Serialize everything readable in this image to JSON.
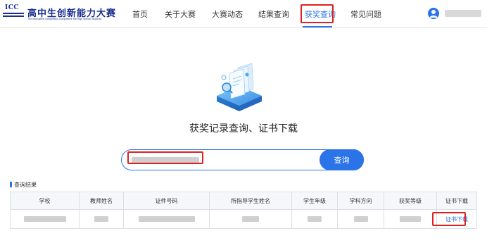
{
  "logo": {
    "abbr": "ICC",
    "name": "高中生创新能力大赛",
    "subtitle": "The Innovative Competition Competitive the High School Students",
    "brand_color": "#1b2f8f"
  },
  "nav": {
    "items": [
      {
        "label": "首页",
        "active": false
      },
      {
        "label": "关于大赛",
        "active": false
      },
      {
        "label": "大赛动态",
        "active": false
      },
      {
        "label": "结果查询",
        "active": false
      },
      {
        "label": "获奖查询",
        "active": true
      },
      {
        "label": "常见问题",
        "active": false
      }
    ],
    "accent_color": "#2a73e8",
    "highlight_color": "#e02020"
  },
  "user": {
    "avatar_icon": "user-avatar-icon"
  },
  "hero": {
    "illustration_icon": "certificate-stack-icon",
    "title": "获奖记录查询、证书下载"
  },
  "search": {
    "placeholder": "",
    "value": "",
    "button_label": "查询"
  },
  "results": {
    "section_label": "查询结果",
    "columns": [
      "学校",
      "教师姓名",
      "证件号码",
      "所指导学生姓名",
      "学生年级",
      "学科方向",
      "获奖等级",
      "证书下载"
    ],
    "rows": [
      {
        "download_label": "证书下载"
      }
    ]
  }
}
